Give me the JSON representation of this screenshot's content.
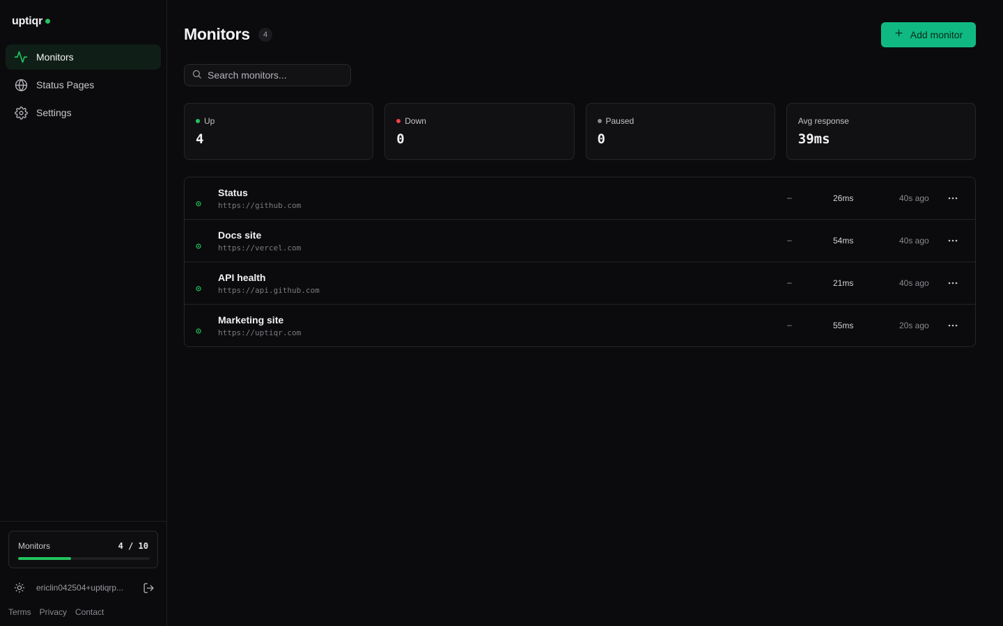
{
  "app": {
    "brand": "uptiqr"
  },
  "sidebar": {
    "items": [
      {
        "label": "Monitors",
        "icon": "activity-icon",
        "active": true
      },
      {
        "label": "Status Pages",
        "icon": "globe-icon",
        "active": false
      },
      {
        "label": "Settings",
        "icon": "gear-icon",
        "active": false
      }
    ],
    "quota": {
      "label": "Monitors",
      "count_text": "4 / 10",
      "used": 4,
      "limit": 10
    },
    "user": {
      "email": "ericlin042504+uptiqrp..."
    },
    "footer": {
      "terms": "Terms",
      "privacy": "Privacy",
      "contact": "Contact"
    }
  },
  "header": {
    "title": "Monitors",
    "count": "4",
    "add_label": "Add monitor"
  },
  "search": {
    "placeholder": "Search monitors..."
  },
  "stats": [
    {
      "label": "Up",
      "value": "4",
      "dot_color": "#22c55e"
    },
    {
      "label": "Down",
      "value": "0",
      "dot_color": "#ef4444"
    },
    {
      "label": "Paused",
      "value": "0",
      "dot_color": "#8a8a90"
    },
    {
      "label": "Avg response",
      "value": "39ms"
    }
  ],
  "monitors": [
    {
      "name": "Status",
      "url": "https://github.com",
      "uptime": "–",
      "response": "26ms",
      "checked": "40s ago"
    },
    {
      "name": "Docs site",
      "url": "https://vercel.com",
      "uptime": "–",
      "response": "54ms",
      "checked": "40s ago"
    },
    {
      "name": "API health",
      "url": "https://api.github.com",
      "uptime": "–",
      "response": "21ms",
      "checked": "40s ago"
    },
    {
      "name": "Marketing site",
      "url": "https://uptiqr.com",
      "uptime": "–",
      "response": "55ms",
      "checked": "20s ago"
    }
  ],
  "colors": {
    "accent": "#10b981",
    "up": "#22c55e",
    "down": "#ef4444",
    "paused": "#8a8a90"
  }
}
